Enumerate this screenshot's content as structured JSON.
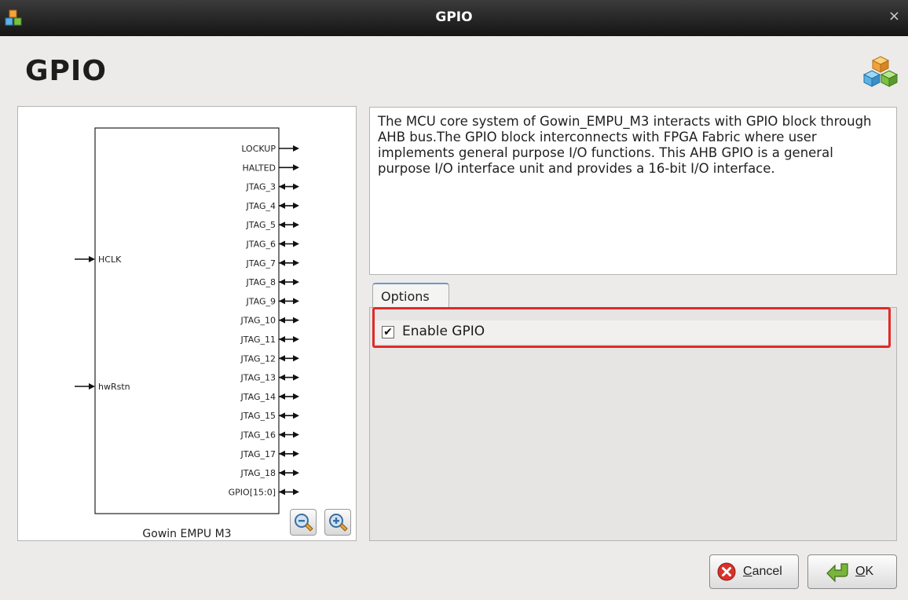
{
  "window": {
    "title": "GPIO",
    "close_glyph": "×"
  },
  "header": {
    "title": "GPIO",
    "icon": "cubes-icon"
  },
  "diagram": {
    "block_name": "Gowin EMPU M3",
    "inputs": [
      "HCLK",
      "hwRstn"
    ],
    "outputs": [
      {
        "label": "LOCKUP",
        "dir": "out"
      },
      {
        "label": "HALTED",
        "dir": "out"
      },
      {
        "label": "JTAG_3",
        "dir": "inout"
      },
      {
        "label": "JTAG_4",
        "dir": "inout"
      },
      {
        "label": "JTAG_5",
        "dir": "inout"
      },
      {
        "label": "JTAG_6",
        "dir": "inout"
      },
      {
        "label": "JTAG_7",
        "dir": "inout"
      },
      {
        "label": "JTAG_8",
        "dir": "inout"
      },
      {
        "label": "JTAG_9",
        "dir": "inout"
      },
      {
        "label": "JTAG_10",
        "dir": "inout"
      },
      {
        "label": "JTAG_11",
        "dir": "inout"
      },
      {
        "label": "JTAG_12",
        "dir": "inout"
      },
      {
        "label": "JTAG_13",
        "dir": "inout"
      },
      {
        "label": "JTAG_14",
        "dir": "inout"
      },
      {
        "label": "JTAG_15",
        "dir": "inout"
      },
      {
        "label": "JTAG_16",
        "dir": "inout"
      },
      {
        "label": "JTAG_17",
        "dir": "inout"
      },
      {
        "label": "JTAG_18",
        "dir": "inout"
      },
      {
        "label": "GPIO[15:0]",
        "dir": "inout"
      }
    ],
    "zoom_out_icon": "zoom-out-icon",
    "zoom_in_icon": "zoom-in-icon"
  },
  "description": "The MCU core system of Gowin_EMPU_M3 interacts with GPIO block through AHB bus.The GPIO block interconnects with FPGA Fabric where user implements general purpose I/O functions. This AHB GPIO is a general purpose I/O interface unit and provides a 16-bit I/O interface.",
  "options": {
    "tab_label": "Options",
    "enable_gpio": {
      "label": "Enable GPIO",
      "checked": true,
      "check_glyph": "✔"
    }
  },
  "buttons": {
    "cancel": {
      "mnemonic": "C",
      "rest": "ancel",
      "icon": "cancel-icon"
    },
    "ok": {
      "mnemonic": "O",
      "rest": "K",
      "icon": "ok-arrow-icon"
    }
  },
  "colors": {
    "highlight": "#e02a2a",
    "tab_accent": "#6d98c8"
  }
}
